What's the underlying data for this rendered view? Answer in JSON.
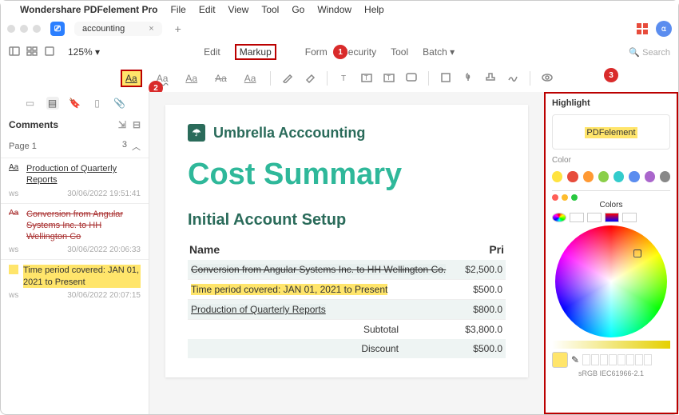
{
  "menubar": {
    "app": "Wondershare PDFelement Pro",
    "items": [
      "File",
      "Edit",
      "View",
      "Tool",
      "Go",
      "Window",
      "Help"
    ]
  },
  "tab": {
    "name": "accounting"
  },
  "zoom": "125%",
  "maintabs": {
    "edit": "Edit",
    "markup": "Markup",
    "form": "Form",
    "security": "Security",
    "tool": "Tool",
    "batch": "Batch"
  },
  "search_placeholder": "Search",
  "sidebar": {
    "header": "Comments",
    "page_label": "Page 1",
    "page_count": "3",
    "items": [
      {
        "author": "ws",
        "text": "Production of Quarterly Reports",
        "ts": "30/06/2022 19:51:41",
        "type": "hl"
      },
      {
        "author": "ws",
        "text": "Conversion from Angular Systems Inc. to HH Wellington Co",
        "ts": "30/06/2022 20:06:33",
        "type": "strike"
      },
      {
        "author": "ws",
        "text": "Time period covered: JAN 01, 2021 to Present",
        "ts": "30/06/2022 20:07:15",
        "type": "yellow"
      }
    ]
  },
  "doc": {
    "brand": "Umbrella Acccounting",
    "title": "Cost Summary",
    "section": "Initial Account Setup",
    "name_hdr": "Name",
    "price_hdr": "Pri",
    "rows": [
      {
        "name": "Conversion from Angular Systems Inc. to HH Wellington Co.",
        "price": "$2,500.0",
        "style": "strike"
      },
      {
        "name": "Time period covered: JAN 01, 2021 to Present",
        "price": "$500.0",
        "style": "hl"
      },
      {
        "name": "Production of Quarterly Reports",
        "price": "$800.0",
        "style": "ul"
      }
    ],
    "subtotal_lbl": "Subtotal",
    "subtotal": "$3,800.0",
    "discount_lbl": "Discount",
    "discount": "$500.0"
  },
  "panel": {
    "title": "Highlight",
    "sample": "PDFelement",
    "color_lbl": "Color",
    "swatches": [
      "#ffe340",
      "#e74c3c",
      "#ff9933",
      "#8bcf4a",
      "#33cccc",
      "#5b8def",
      "#aa66cc",
      "#888888"
    ],
    "picker_title": "Colors",
    "profile": "sRGB IEC61966-2.1"
  },
  "callouts": {
    "c1": "1",
    "c2": "2",
    "c3": "3"
  }
}
